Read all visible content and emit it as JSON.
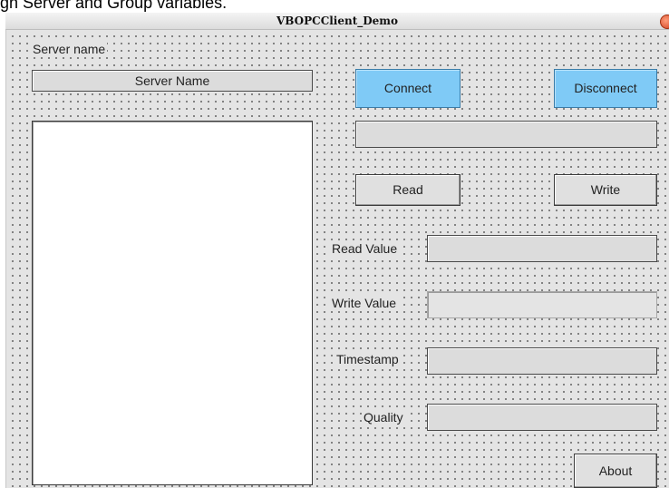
{
  "caption_text": "gh Server and Group variables.",
  "window": {
    "title": "VBOPCClient_Demo"
  },
  "server": {
    "label": "Server name",
    "field_value": "Server Name"
  },
  "buttons": {
    "connect": "Connect",
    "disconnect": "Disconnect",
    "read": "Read",
    "write": "Write",
    "about": "About"
  },
  "fields": {
    "read_value_label": "Read Value",
    "write_value_label": "Write Value",
    "timestamp_label": "Timestamp",
    "quality_label": "Quality",
    "status_value": "",
    "read_value": "",
    "write_value": "",
    "timestamp_value": "",
    "quality_value": ""
  },
  "colors": {
    "accent_button": "#7fcaf6",
    "form_background": "#e4e4e4"
  },
  "icons": {
    "close": "close-icon"
  }
}
